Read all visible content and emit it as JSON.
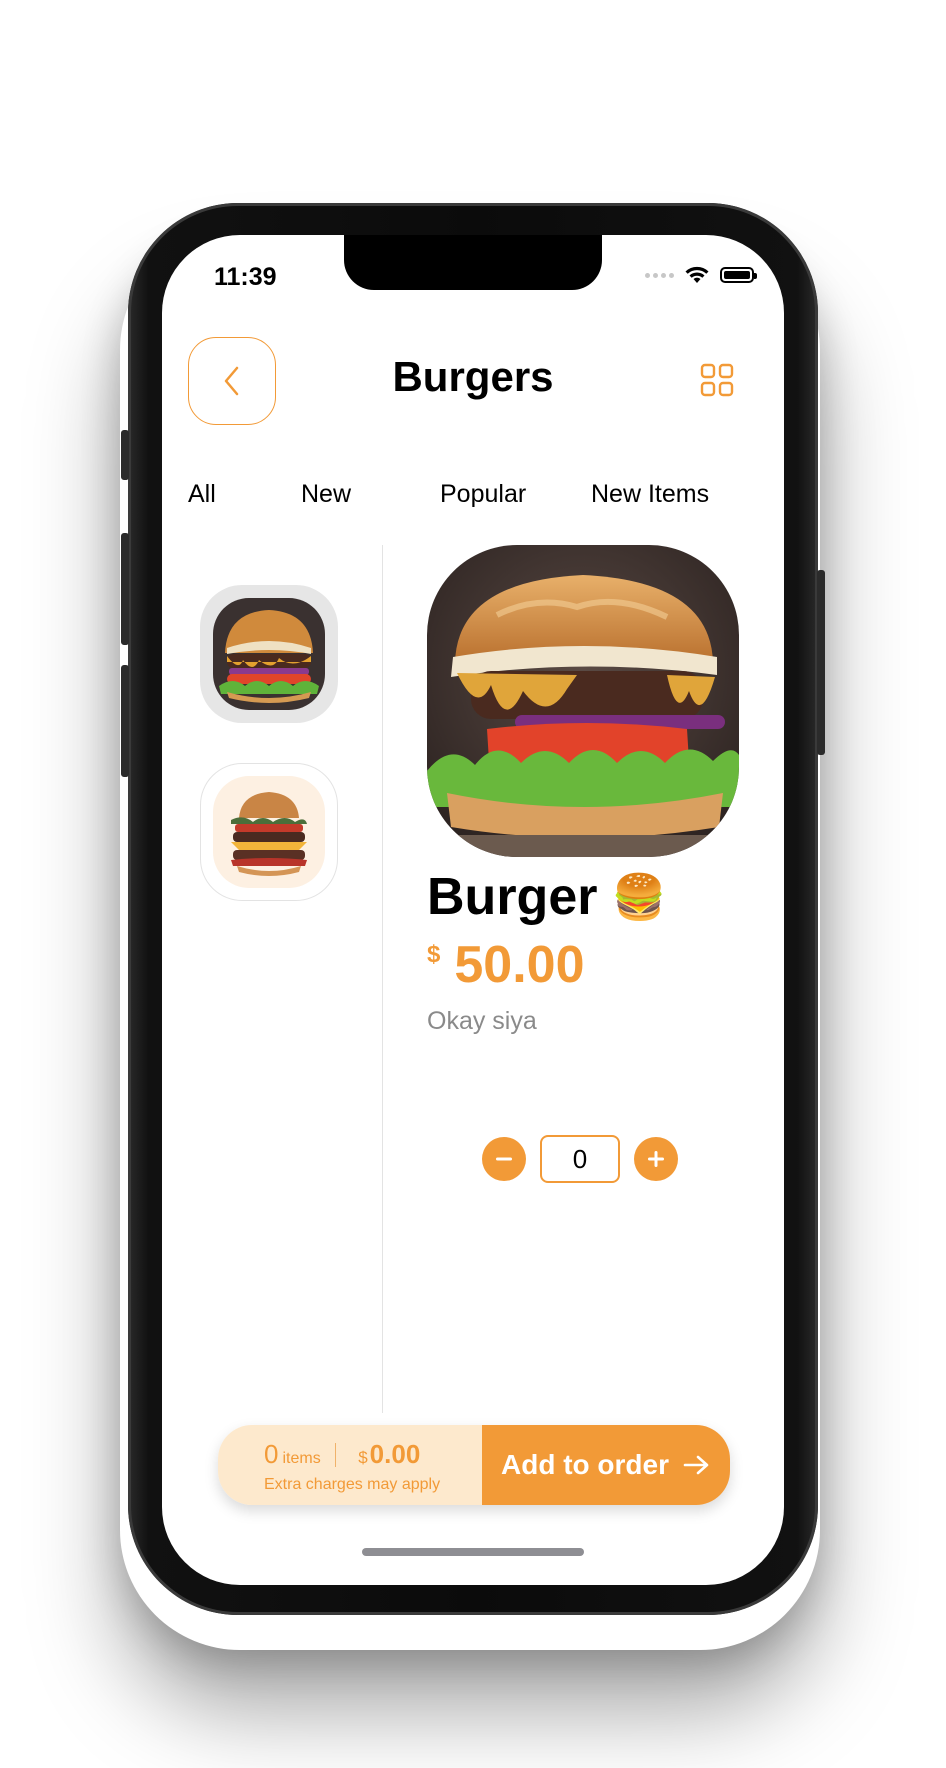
{
  "status_bar": {
    "time": "11:39"
  },
  "header": {
    "title": "Burgers",
    "back_icon": "chevron-left-icon",
    "grid_icon": "grid-icon"
  },
  "tabs": [
    {
      "label": "All"
    },
    {
      "label": "New"
    },
    {
      "label": "Popular"
    },
    {
      "label": "New Items"
    }
  ],
  "thumbnails": [
    {
      "name": "burger-photo-1",
      "selected": true
    },
    {
      "name": "burger-photo-2",
      "selected": false
    }
  ],
  "item": {
    "name": "Burger",
    "emoji": "🍔",
    "currency": "$",
    "price": "50.00",
    "description": "Okay siya"
  },
  "quantity": {
    "value": "0",
    "minus_icon": "minus-icon",
    "plus_icon": "plus-icon"
  },
  "order_bar": {
    "count": "0",
    "count_label": "items",
    "currency": "$",
    "total": "0.00",
    "note": "Extra charges may apply",
    "button_label": "Add to order",
    "arrow_icon": "arrow-right-icon"
  },
  "colors": {
    "accent": "#f29a37",
    "accent_light": "#fde9cd",
    "text": "#000000",
    "muted": "#8a8a8a"
  }
}
